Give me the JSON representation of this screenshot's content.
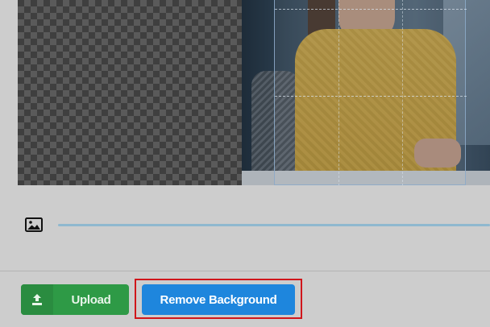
{
  "buttons": {
    "upload_label": "Upload",
    "remove_background_label": "Remove Background"
  },
  "slider": {
    "icon": "image-icon"
  },
  "colors": {
    "upload_button": "#2e9a46",
    "remove_background_button": "#1e86dd",
    "highlight_frame": "#d0161b",
    "slider_track": "#8fb8cf"
  }
}
